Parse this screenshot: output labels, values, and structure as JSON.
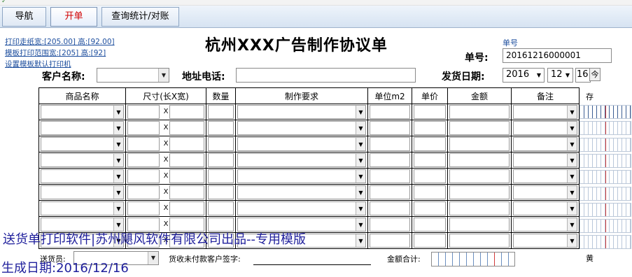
{
  "tabs": [
    {
      "label": "导航"
    },
    {
      "label": "开单"
    },
    {
      "label": "查询统计/对账"
    }
  ],
  "settings_links": {
    "paper_size": "打印走纸宽:[205.00] 高:[92.00]",
    "print_range": "模板打印范围宽:[205] 高:[92]",
    "default_printer": "设置模板默认打印机"
  },
  "form_title": "杭州XXX广告制作协议单",
  "order_no": {
    "caption": "单号",
    "label": "单号:",
    "value": "20161216000001"
  },
  "customer": {
    "label": "客户名称:",
    "value": ""
  },
  "address": {
    "label": "地址电话:",
    "value": ""
  },
  "ship_date": {
    "label": "发货日期:",
    "year": "2016",
    "month": "12",
    "day": "16",
    "spin_label": "今"
  },
  "table": {
    "columns": [
      "商品名称",
      "尺寸(长X宽)",
      "数量",
      "制作要求",
      "单位m2",
      "单价",
      "金额",
      "备注"
    ],
    "dim_separator": "X",
    "row_count": 9
  },
  "side_label_top": "存",
  "side_label_bottom": "黄",
  "footer": {
    "deliverer_label": "送货员:",
    "signature_label": "货收未付款客户签字:",
    "total_label": "金额合计:"
  },
  "watermark": {
    "line1": "送货单打印软件|苏州飓风软件有限公司出品--专用模版",
    "line2_prefix": "生成日期:",
    "line2_date": "2016/12/16"
  },
  "colors": {
    "active_tab_text": "#d00000",
    "link": "#1d4e9e",
    "watermark": "#1f1f9c"
  }
}
